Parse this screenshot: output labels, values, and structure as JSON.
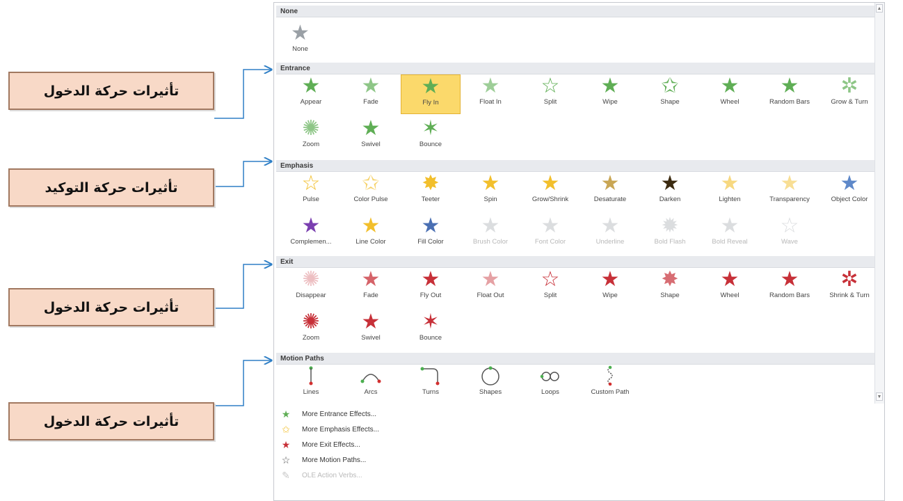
{
  "sections": {
    "none": {
      "title": "None",
      "items": [
        {
          "label": "None",
          "icon": "star-gray-icon"
        }
      ]
    },
    "entrance": {
      "title": "Entrance",
      "row1": [
        "Appear",
        "Fade",
        "Fly In",
        "Float In",
        "Split",
        "Wipe",
        "Shape",
        "Wheel",
        "Random Bars",
        "Grow & Turn"
      ],
      "row2": [
        "Zoom",
        "Swivel",
        "Bounce"
      ],
      "selected": "Fly In"
    },
    "emphasis": {
      "title": "Emphasis",
      "row1": [
        "Pulse",
        "Color Pulse",
        "Teeter",
        "Spin",
        "Grow/Shrink",
        "Desaturate",
        "Darken",
        "Lighten",
        "Transparency",
        "Object Color"
      ],
      "row2": [
        "Complemen...",
        "Line Color",
        "Fill Color",
        "Brush Color",
        "Font Color",
        "Underline",
        "Bold Flash",
        "Bold Reveal",
        "Wave"
      ]
    },
    "exit": {
      "title": "Exit",
      "row1": [
        "Disappear",
        "Fade",
        "Fly Out",
        "Float Out",
        "Split",
        "Wipe",
        "Shape",
        "Wheel",
        "Random Bars",
        "Shrink & Turn"
      ],
      "row2": [
        "Zoom",
        "Swivel",
        "Bounce"
      ]
    },
    "motion": {
      "title": "Motion Paths",
      "row1": [
        "Lines",
        "Arcs",
        "Turns",
        "Shapes",
        "Loops",
        "Custom Path"
      ]
    }
  },
  "menu": [
    {
      "label": "More Entrance Effects...",
      "icon": "green-star-icon",
      "enabled": true
    },
    {
      "label": "More Emphasis Effects...",
      "icon": "yellow-star-icon",
      "enabled": true
    },
    {
      "label": "More Exit Effects...",
      "icon": "red-star-icon",
      "enabled": true
    },
    {
      "label": "More Motion Paths...",
      "icon": "outline-star-icon",
      "enabled": true
    },
    {
      "label": "OLE Action Verbs...",
      "icon": "pencil-icon",
      "enabled": false
    }
  ],
  "callouts": [
    "تأثيرات حركة الدخول",
    "تأثيرات حركة التوكيد",
    "تأثيرات حركة الدخول",
    "تأثيرات حركة الدخول"
  ],
  "colors": {
    "entrance": "#5fae55",
    "emphasis": "#f2bf2c",
    "exit": "#c73038",
    "selected": "#fbd96b",
    "callout_fill": "#f8d9c7",
    "connector": "#2f7fc6"
  }
}
